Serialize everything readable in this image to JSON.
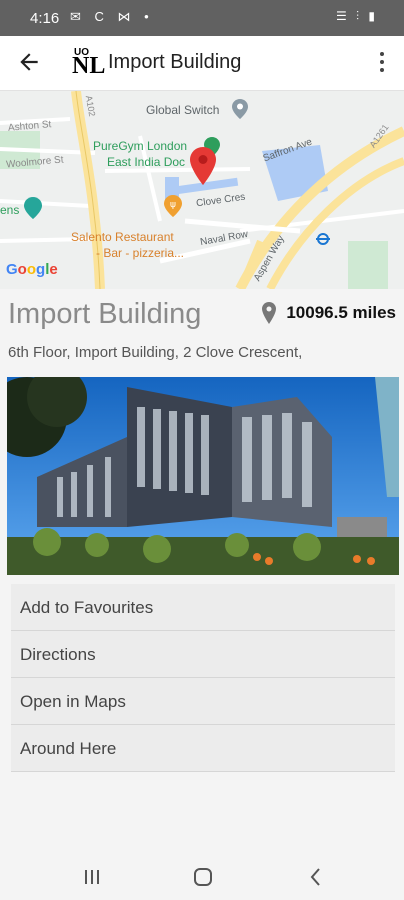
{
  "status": {
    "time": "4:16",
    "left_icons": "✉ C ⋈ •",
    "right_icons": "☰ ⫶ ▮"
  },
  "appbar": {
    "title": "Import Building",
    "logo_small": "UO",
    "logo_big": "NL"
  },
  "map": {
    "labels": {
      "global_switch": "Global Switch",
      "puregym": "PureGym London East India Dock",
      "saffron": "Saffron Ave",
      "clove": "Clove Cres",
      "salento": "Salento Restaurant - Bar - pizzeria...",
      "naval": "Naval Row",
      "aspen": "Aspen Way",
      "ashton": "Ashton St",
      "woolmore": "Woolmore St",
      "ens": "ens",
      "a102": "A102",
      "a1261": "A1261",
      "google": "Google"
    }
  },
  "place": {
    "title": "Import Building",
    "distance": "10096.5 miles",
    "address": "6th Floor, Import Building, 2 Clove Crescent,"
  },
  "actions": [
    "Add to Favourites",
    "Directions",
    "Open in Maps",
    " Around Here"
  ],
  "colors": {
    "status": "#616161",
    "pin": "#e53935",
    "road": "#fbe39a"
  }
}
